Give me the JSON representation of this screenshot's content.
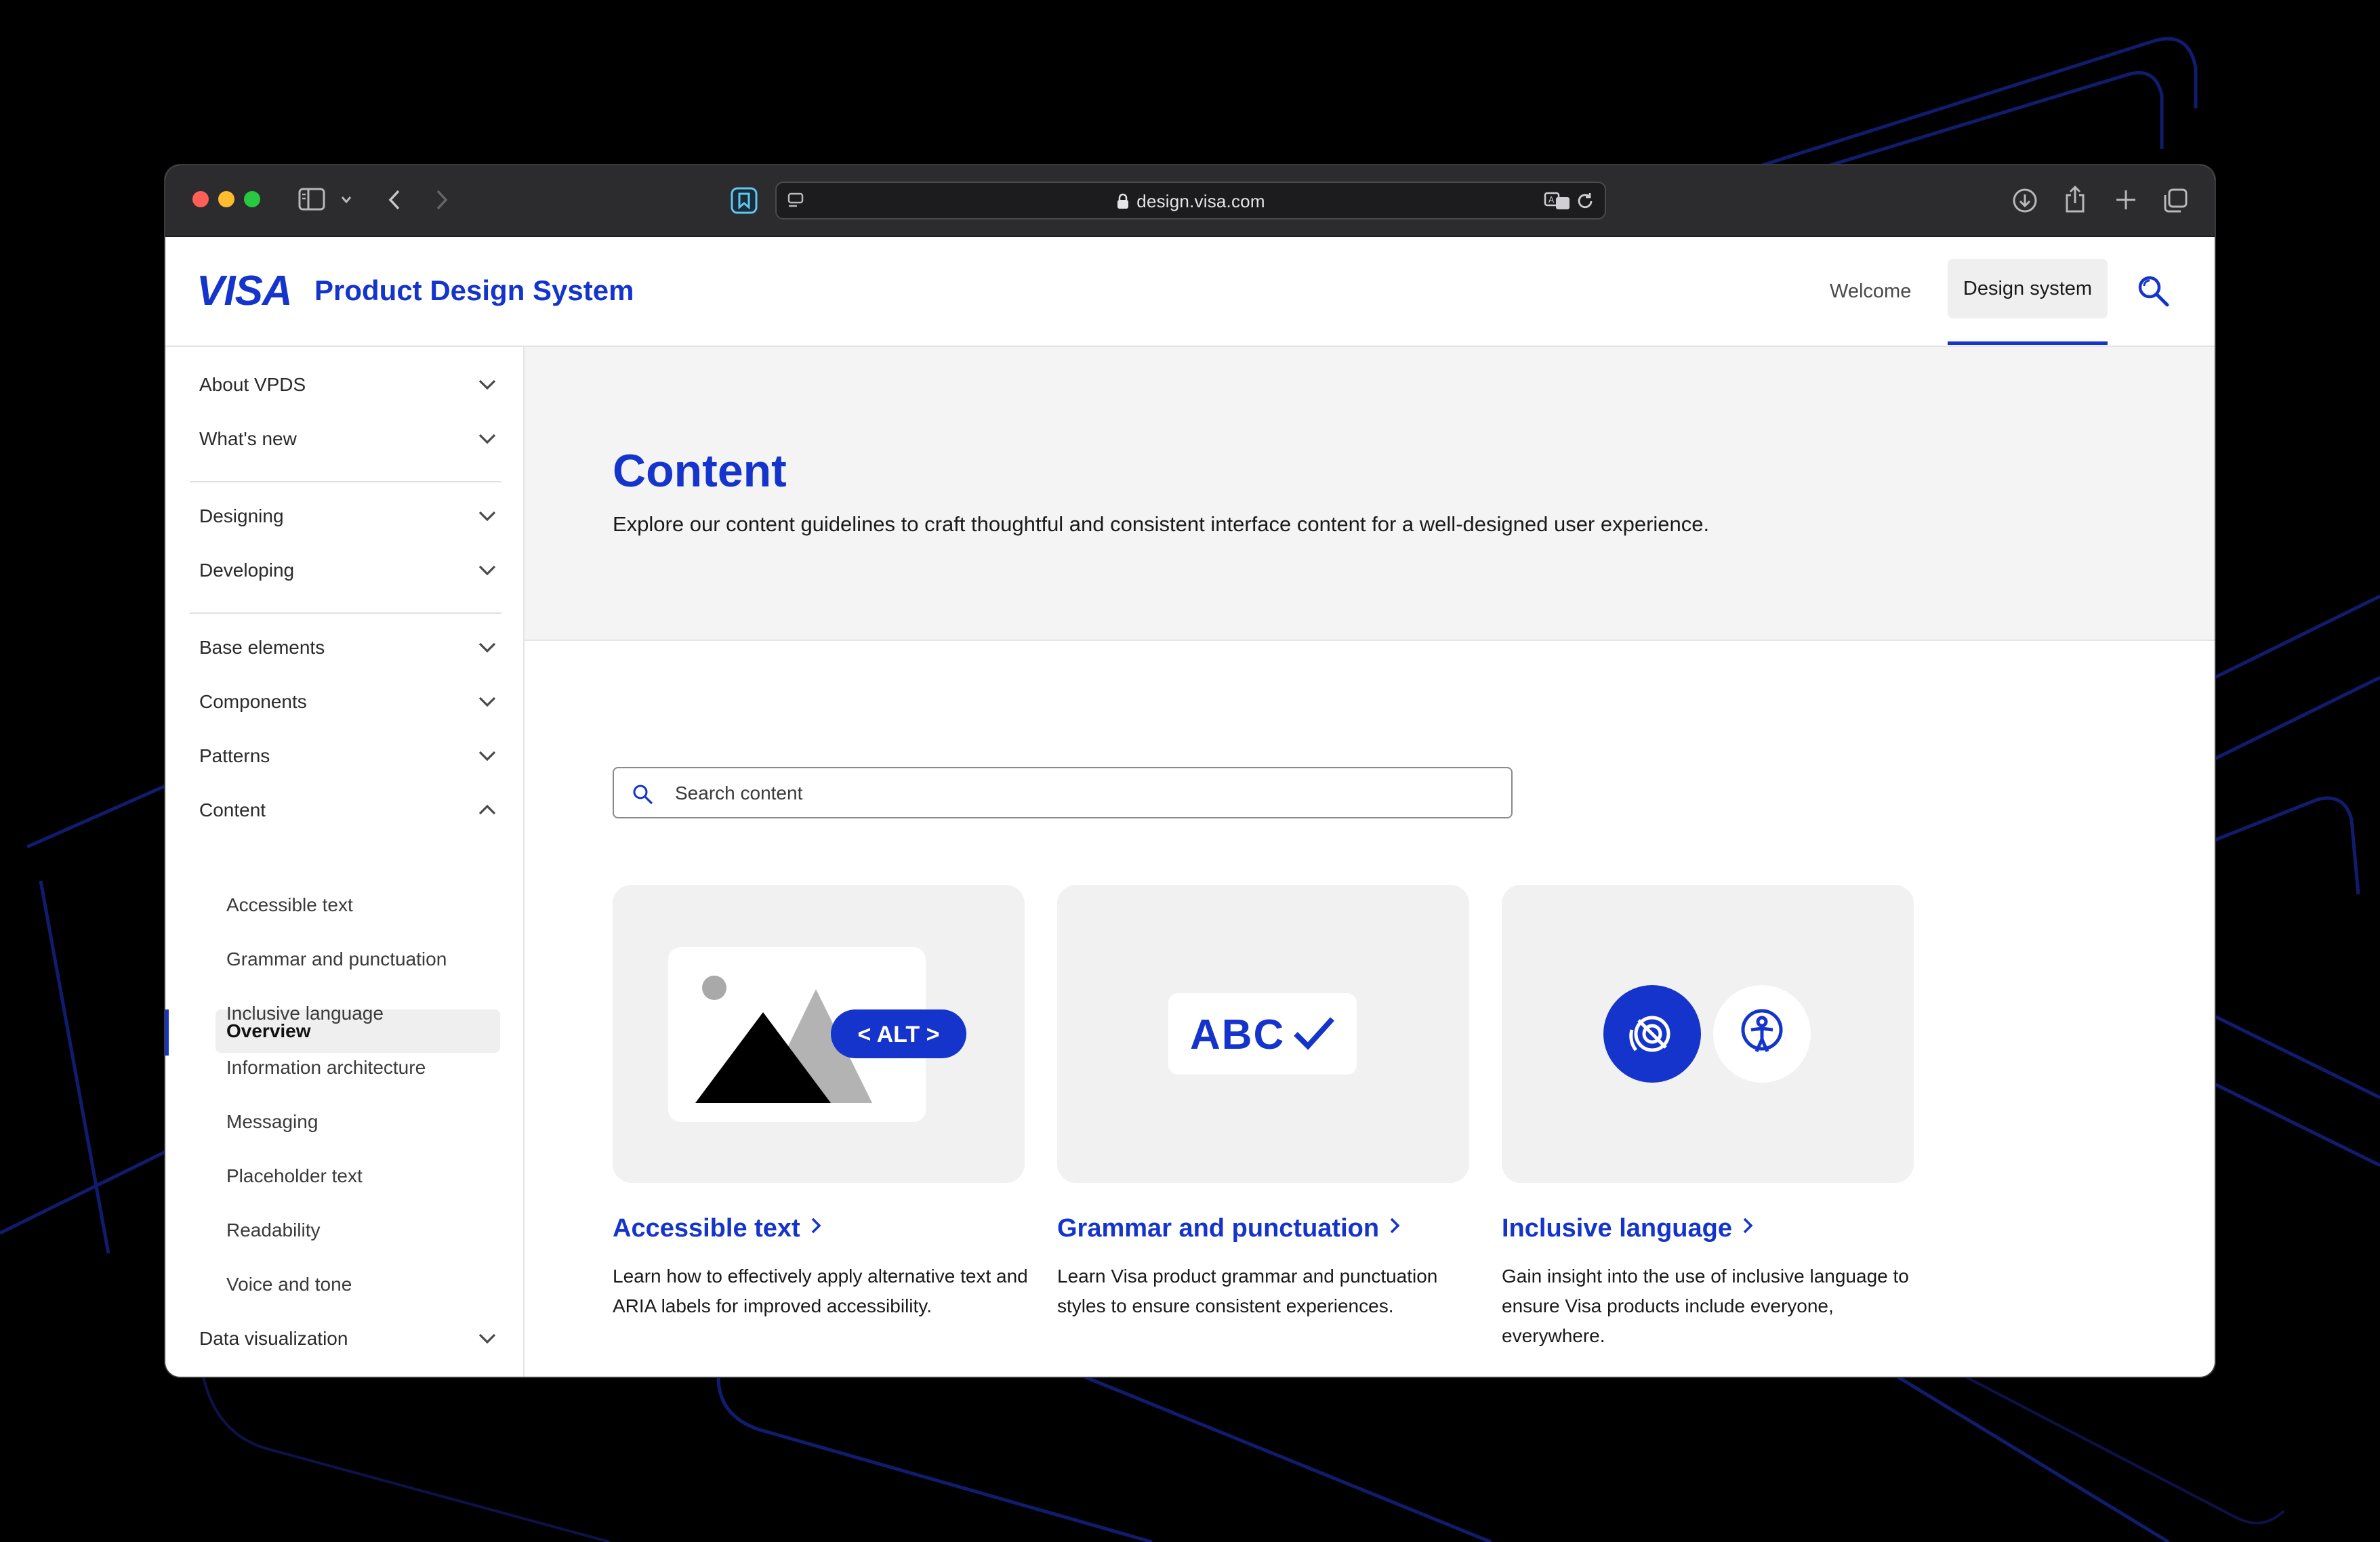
{
  "browser": {
    "url": "design.visa.com",
    "icons": [
      "sidebar-icon",
      "chevron-down-icon",
      "back-icon",
      "forward-icon",
      "extension-icon",
      "tab-overview-icon",
      "lock-icon",
      "translate-icon",
      "reload-icon",
      "download-icon",
      "share-icon",
      "new-tab-icon",
      "tabs-icon"
    ]
  },
  "header": {
    "logo": "VISA",
    "title": "Product Design System",
    "nav": {
      "welcome": "Welcome",
      "design_system": "Design system"
    }
  },
  "sidebar": {
    "groups": [
      {
        "label": "About VPDS",
        "expanded": false
      },
      {
        "label": "What's new",
        "expanded": false
      },
      {
        "label": "Designing",
        "expanded": false
      },
      {
        "label": "Developing",
        "expanded": false
      },
      {
        "label": "Base elements",
        "expanded": false
      },
      {
        "label": "Components",
        "expanded": false
      },
      {
        "label": "Patterns",
        "expanded": false
      },
      {
        "label": "Content",
        "expanded": true
      },
      {
        "label": "Data visualization",
        "expanded": false
      }
    ],
    "content_items": [
      {
        "label": "Overview",
        "active": true
      },
      {
        "label": "Accessible text",
        "active": false
      },
      {
        "label": "Grammar and punctuation",
        "active": false
      },
      {
        "label": "Inclusive language",
        "active": false
      },
      {
        "label": "Information architecture",
        "active": false
      },
      {
        "label": "Messaging",
        "active": false
      },
      {
        "label": "Placeholder text",
        "active": false
      },
      {
        "label": "Readability",
        "active": false
      },
      {
        "label": "Voice and tone",
        "active": false
      }
    ]
  },
  "hero": {
    "title": "Content",
    "description": "Explore our content guidelines to craft thoughtful and consistent interface content for a well-designed user experience."
  },
  "search": {
    "placeholder": "Search content",
    "value": ""
  },
  "cards": [
    {
      "title": "Accessible text",
      "description": "Learn how to effectively apply alternative text and ARIA labels for improved accessibility.",
      "badge": "< ALT >"
    },
    {
      "title": "Grammar and punctuation",
      "description": "Learn Visa product grammar and punctuation styles to ensure consistent experiences.",
      "badge": "ABC"
    },
    {
      "title": "Inclusive language",
      "description": "Gain insight into the use of inclusive language to ensure Visa products include everyone, everywhere."
    }
  ],
  "colors": {
    "brand_blue": "#1434cb",
    "hero_bg": "#f4f4f4",
    "card_bg": "#f1f1f1",
    "toolbar_bg": "#2c2c2e"
  }
}
